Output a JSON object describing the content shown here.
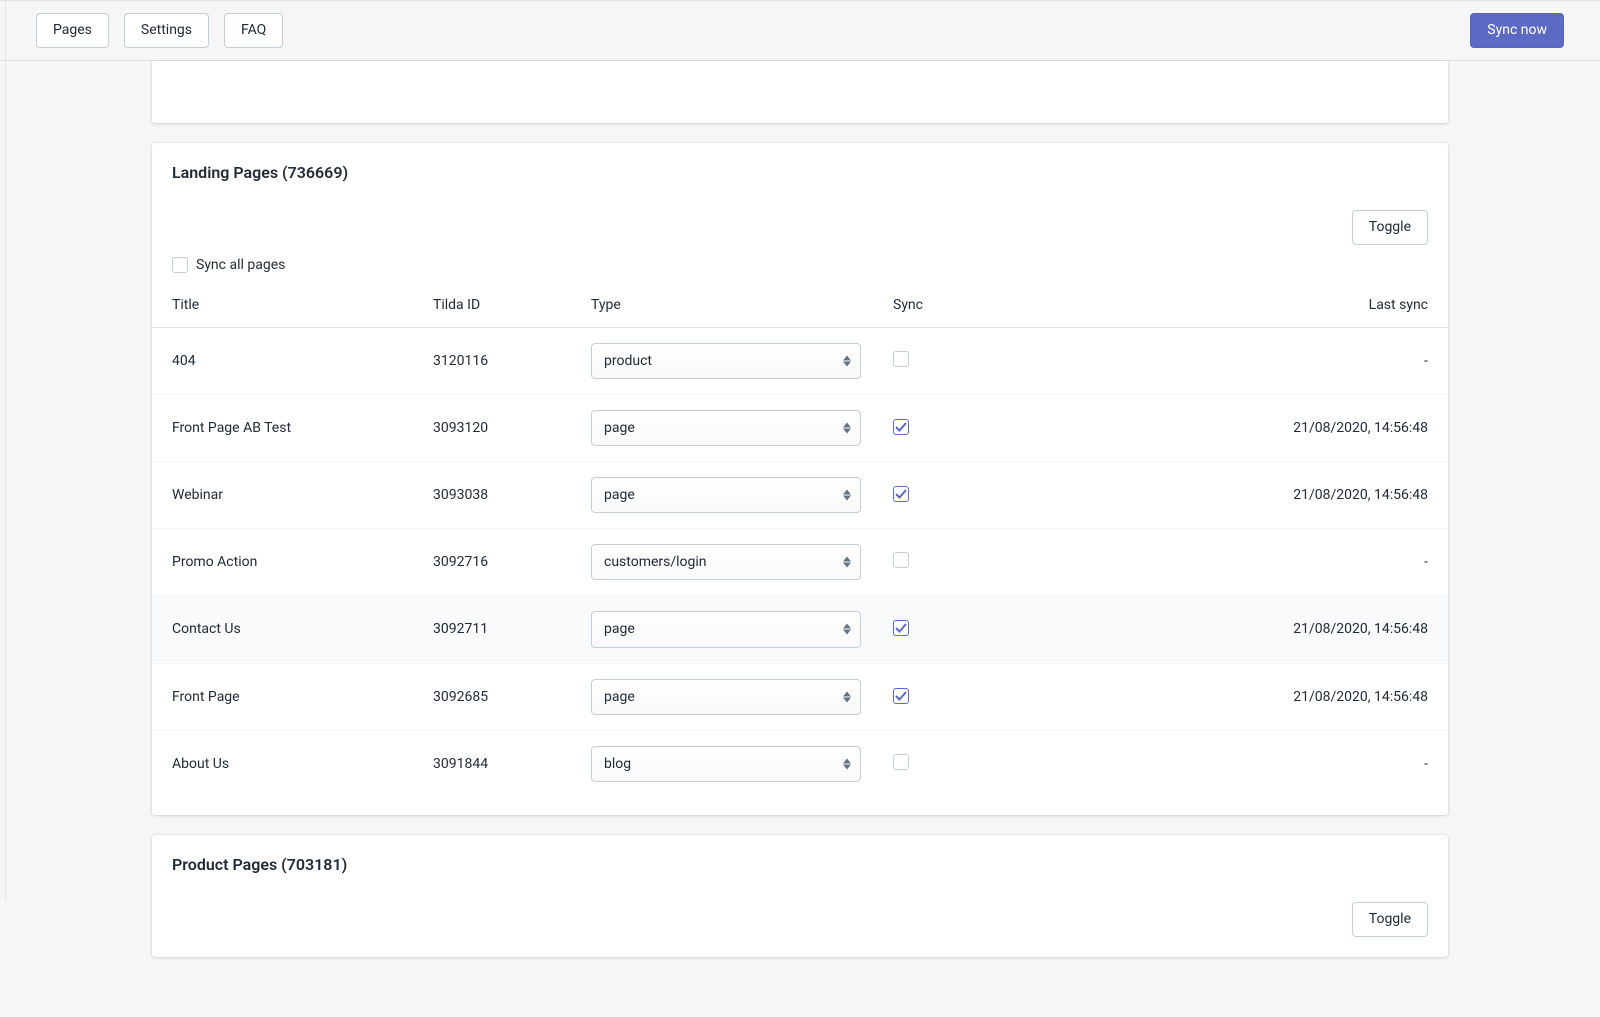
{
  "topbar": {
    "pages": "Pages",
    "settings": "Settings",
    "faq": "FAQ",
    "sync_now": "Sync now"
  },
  "sections": [
    {
      "title": "Landing Pages (736669)",
      "toggle_label": "Toggle",
      "sync_all_label": "Sync all pages",
      "sync_all_checked": false,
      "columns": {
        "title": "Title",
        "tilda_id": "Tilda ID",
        "type": "Type",
        "sync": "Sync",
        "last_sync": "Last sync"
      },
      "rows": [
        {
          "title": "404",
          "tilda_id": "3120116",
          "type": "product",
          "sync": false,
          "last_sync": "-"
        },
        {
          "title": "Front Page AB Test",
          "tilda_id": "3093120",
          "type": "page",
          "sync": true,
          "last_sync": "21/08/2020, 14:56:48"
        },
        {
          "title": "Webinar",
          "tilda_id": "3093038",
          "type": "page",
          "sync": true,
          "last_sync": "21/08/2020, 14:56:48"
        },
        {
          "title": "Promo Action",
          "tilda_id": "3092716",
          "type": "customers/login",
          "sync": false,
          "last_sync": "-"
        },
        {
          "title": "Contact Us",
          "tilda_id": "3092711",
          "type": "page",
          "sync": true,
          "last_sync": "21/08/2020, 14:56:48",
          "hovered": true
        },
        {
          "title": "Front Page",
          "tilda_id": "3092685",
          "type": "page",
          "sync": true,
          "last_sync": "21/08/2020, 14:56:48"
        },
        {
          "title": "About Us",
          "tilda_id": "3091844",
          "type": "blog",
          "sync": false,
          "last_sync": "-"
        }
      ]
    },
    {
      "title": "Product Pages (703181)",
      "toggle_label": "Toggle"
    }
  ]
}
